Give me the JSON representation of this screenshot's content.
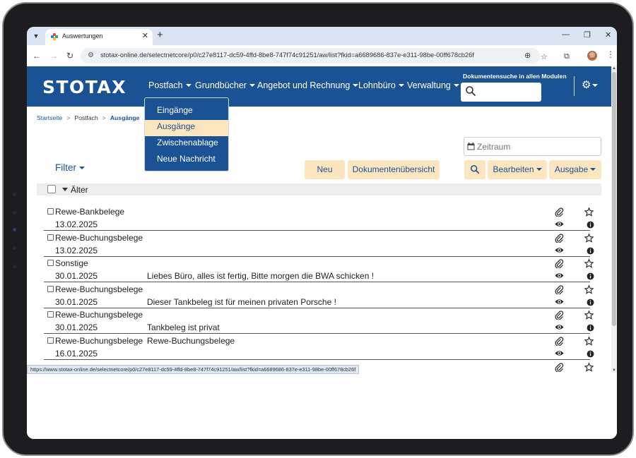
{
  "browser": {
    "tab_title": "Auswertungen",
    "url": "stotax-online.de/selectnetcore/p0/c27e8117-dc59-4ffd-8be8-747f74c91251/aw/list?fkid=a6689686-837e-e311-98be-00ff678cb26f",
    "status_url": "https://www.stotax-online.de/selectnetcore/p0/c27e8117-dc59-4ffd-8be8-747f74c91251/aw/list?fkid=a6689686-837e-e311-98be-00ff678cb26f"
  },
  "header": {
    "logo": "STOTAX",
    "menu": [
      "Postfach",
      "Grundbücher",
      "Angebot und Rechnung",
      "Lohnbüro",
      "Verwaltung"
    ],
    "docsearch_label": "Dokumentensuche in allen Modulen"
  },
  "dropdown": {
    "items": [
      "Eingänge",
      "Ausgänge",
      "Zwischenablage",
      "Neue Nachricht"
    ],
    "active_index": 1
  },
  "breadcrumb": {
    "home": "Startseite",
    "section": "Postfach",
    "current": "Ausgänge"
  },
  "toolbar": {
    "filter": "Filter",
    "zeitraum_placeholder": "Zeitraum",
    "neu": "Neu",
    "dokumentenuebersicht": "Dokumentenübersicht",
    "bearbeiten": "Bearbeiten",
    "ausgabe": "Ausgabe"
  },
  "group": {
    "label": "Älter"
  },
  "rows": [
    {
      "category": "Rewe-Bankbelege",
      "date": "13.02.2025",
      "message": "",
      "message_top": ""
    },
    {
      "category": "Rewe-Buchungsbelege",
      "date": "13.02.2025",
      "message": "",
      "message_top": ""
    },
    {
      "category": "Sonstige",
      "date": "30.01.2025",
      "message": "Liebes Büro, alles ist fertig, Bitte morgen die BWA schicken !",
      "message_top": ""
    },
    {
      "category": "Rewe-Buchungsbelege",
      "date": "30.01.2025",
      "message": "Dieser Tankbeleg ist für meinen privaten Porsche !",
      "message_top": ""
    },
    {
      "category": "Rewe-Buchungsbelege",
      "date": "30.01.2025",
      "message": "Tankbeleg ist privat",
      "message_top": ""
    },
    {
      "category": "Rewe-Buchungsbelege",
      "date": "16.01.2025",
      "message": "",
      "message_top": "Rewe-Buchungsbelege"
    }
  ],
  "colors": {
    "brand_blue": "#1b5293",
    "button_bg": "#fde6bf",
    "active_item_bg": "#fde6bf"
  },
  "icons": [
    "paperclip-icon",
    "star-icon",
    "eye-icon",
    "info-icon",
    "search-icon",
    "gear-icon",
    "calendar-icon"
  ]
}
